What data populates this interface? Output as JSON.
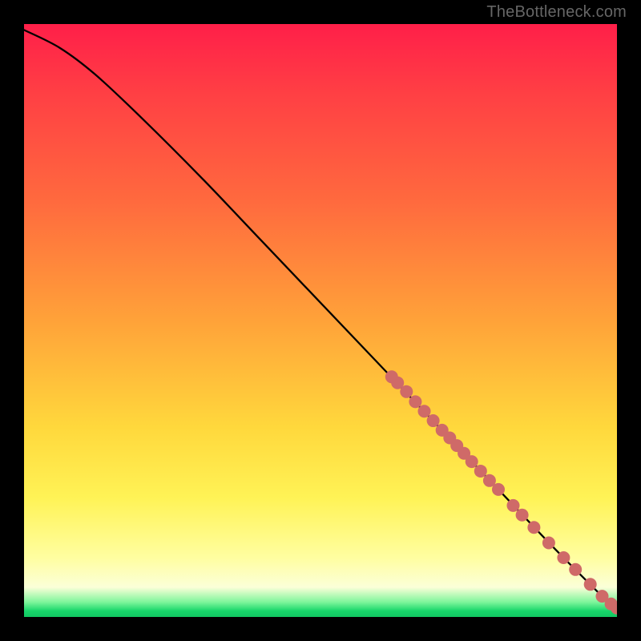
{
  "watermark": "TheBottleneck.com",
  "colors": {
    "background": "#000000",
    "curve_stroke": "#000000",
    "point_fill": "#cf6a68",
    "gradient_top": "#ff1f49",
    "gradient_bottom": "#12c762"
  },
  "chart_data": {
    "type": "line",
    "title": "",
    "xlabel": "",
    "ylabel": "",
    "x_range": [
      0,
      100
    ],
    "y_range": [
      0,
      100
    ],
    "curve": [
      {
        "x": 0,
        "y": 99
      },
      {
        "x": 6,
        "y": 96
      },
      {
        "x": 12,
        "y": 91.5
      },
      {
        "x": 20,
        "y": 84
      },
      {
        "x": 30,
        "y": 74
      },
      {
        "x": 40,
        "y": 63.5
      },
      {
        "x": 50,
        "y": 53
      },
      {
        "x": 60,
        "y": 42.5
      },
      {
        "x": 70,
        "y": 32
      },
      {
        "x": 80,
        "y": 21.5
      },
      {
        "x": 90,
        "y": 11
      },
      {
        "x": 100,
        "y": 1
      }
    ],
    "series": [
      {
        "name": "highlighted-points",
        "points": [
          {
            "x": 62.0,
            "y": 40.5
          },
          {
            "x": 63.0,
            "y": 39.5
          },
          {
            "x": 64.5,
            "y": 38.0
          },
          {
            "x": 66.0,
            "y": 36.3
          },
          {
            "x": 67.5,
            "y": 34.7
          },
          {
            "x": 69.0,
            "y": 33.1
          },
          {
            "x": 70.5,
            "y": 31.5
          },
          {
            "x": 71.8,
            "y": 30.2
          },
          {
            "x": 73.0,
            "y": 28.9
          },
          {
            "x": 74.2,
            "y": 27.6
          },
          {
            "x": 75.5,
            "y": 26.2
          },
          {
            "x": 77.0,
            "y": 24.6
          },
          {
            "x": 78.5,
            "y": 23.0
          },
          {
            "x": 80.0,
            "y": 21.5
          },
          {
            "x": 82.5,
            "y": 18.8
          },
          {
            "x": 84.0,
            "y": 17.2
          },
          {
            "x": 86.0,
            "y": 15.1
          },
          {
            "x": 88.5,
            "y": 12.5
          },
          {
            "x": 91.0,
            "y": 10.0
          },
          {
            "x": 93.0,
            "y": 8.0
          },
          {
            "x": 95.5,
            "y": 5.5
          },
          {
            "x": 97.5,
            "y": 3.5
          },
          {
            "x": 99.0,
            "y": 2.2
          },
          {
            "x": 100.0,
            "y": 1.5
          }
        ],
        "point_radius": 8
      }
    ]
  }
}
